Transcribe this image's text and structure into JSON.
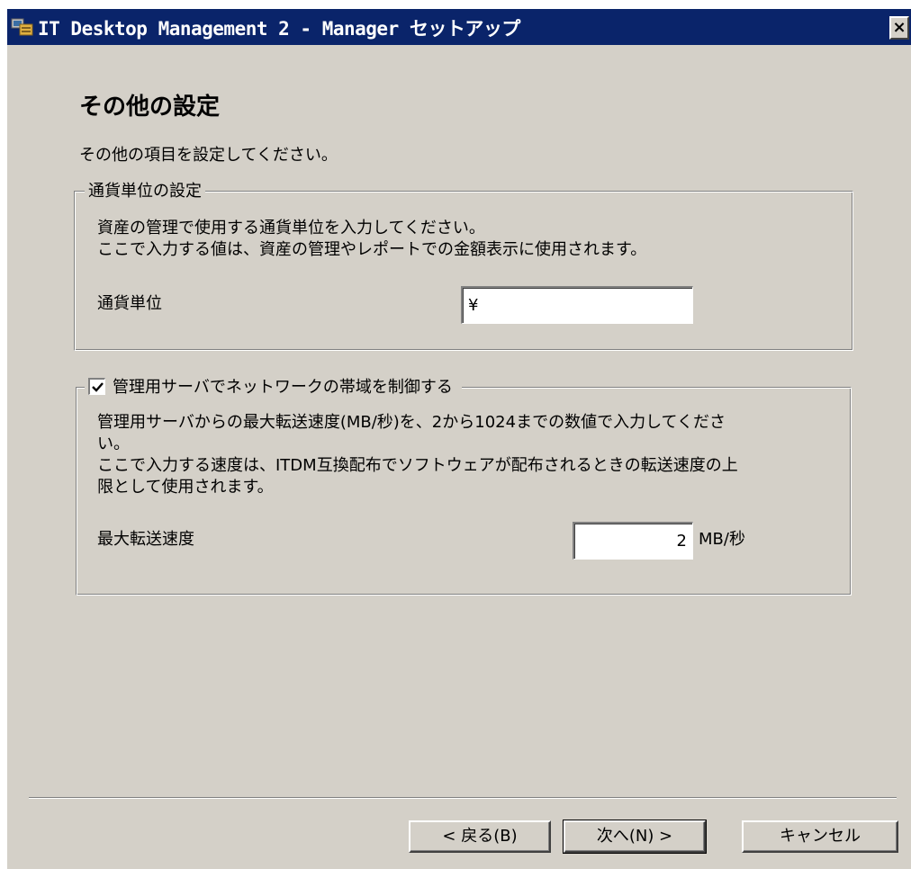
{
  "window": {
    "title": "IT Desktop Management 2 - Manager セットアップ",
    "close_label": "×"
  },
  "page": {
    "heading": "その他の設定",
    "subheading": "その他の項目を設定してください。"
  },
  "currency_group": {
    "legend": "通貨単位の設定",
    "description_line1": "資産の管理で使用する通貨単位を入力してください。",
    "description_line2": "ここで入力する値は、資産の管理やレポートでの金額表示に使用されます。",
    "field_label": "通貨単位",
    "field_value": "¥"
  },
  "bandwidth_group": {
    "checkbox_label": "管理用サーバでネットワークの帯域を制御する",
    "checkbox_checked": true,
    "description_line1": "管理用サーバからの最大転送速度(MB/秒)を、2から1024までの数値で入力してくださ",
    "description_line2": "い。",
    "description_line3": "ここで入力する速度は、ITDM互換配布でソフトウェアが配布されるときの転送速度の上",
    "description_line4": "限として使用されます。",
    "field_label": "最大転送速度",
    "field_value": "2",
    "unit": "MB/秒"
  },
  "buttons": {
    "back": "< 戻る(B)",
    "next": "次へ(N) >",
    "cancel": "キャンセル"
  }
}
